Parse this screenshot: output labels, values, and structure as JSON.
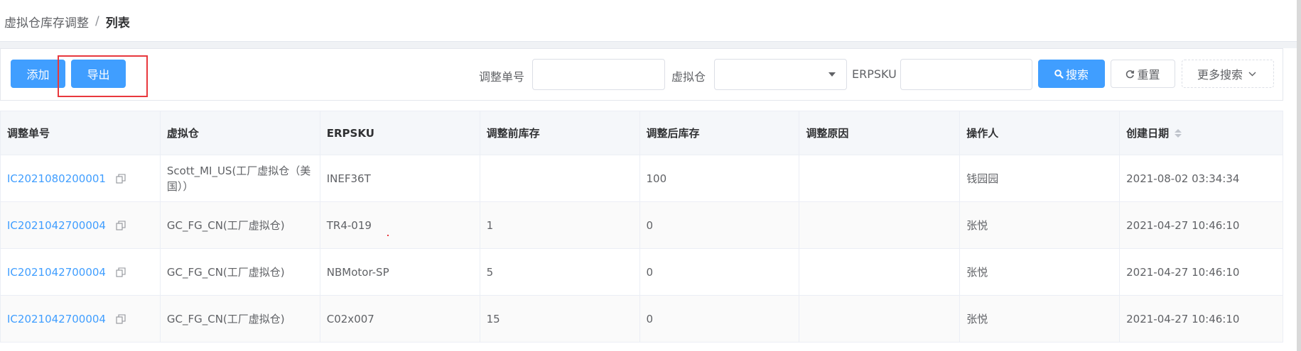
{
  "breadcrumb": {
    "parent": "虚拟仓库存调整",
    "separator": "/",
    "current": "列表"
  },
  "toolbar": {
    "add_label": "添加",
    "export_label": "导出",
    "filters": {
      "adjust_no_label": "调整单号",
      "adjust_no_value": "",
      "warehouse_label": "虚拟仓",
      "warehouse_value": "",
      "erpsku_label": "ERPSKU",
      "erpsku_value": ""
    },
    "search_label": "搜索",
    "reset_label": "重置",
    "more_search_label": "更多搜索"
  },
  "table": {
    "columns": [
      "调整单号",
      "虚拟仓",
      "ERPSKU",
      "调整前库存",
      "调整后库存",
      "调整原因",
      "操作人",
      "创建日期"
    ],
    "rows": [
      {
        "adjust_no": "IC2021080200001",
        "warehouse": "Scott_MI_US(工厂虚拟仓（美国））",
        "erpsku": "INEF36T",
        "before": "",
        "after": "100",
        "reason": "",
        "operator": "钱园园",
        "created": "2021-08-02 03:34:34"
      },
      {
        "adjust_no": "IC2021042700004",
        "warehouse": "GC_FG_CN(工厂虚拟仓)",
        "erpsku": "TR4-019",
        "before": "1",
        "after": "0",
        "reason": "",
        "operator": "张悦",
        "created": "2021-04-27 10:46:10"
      },
      {
        "adjust_no": "IC2021042700004",
        "warehouse": "GC_FG_CN(工厂虚拟仓)",
        "erpsku": "NBMotor-SP",
        "before": "5",
        "after": "0",
        "reason": "",
        "operator": "张悦",
        "created": "2021-04-27 10:46:10"
      },
      {
        "adjust_no": "IC2021042700004",
        "warehouse": "GC_FG_CN(工厂虚拟仓)",
        "erpsku": "C02x007",
        "before": "15",
        "after": "0",
        "reason": "",
        "operator": "张悦",
        "created": "2021-04-27 10:46:10"
      }
    ]
  },
  "colors": {
    "primary": "#409eff",
    "highlight": "#e8383d",
    "header_bg": "#f5f7fa"
  },
  "icons": [
    "refresh-icon",
    "search-icon",
    "chevron-down-icon",
    "copy-icon",
    "sort-icon"
  ]
}
